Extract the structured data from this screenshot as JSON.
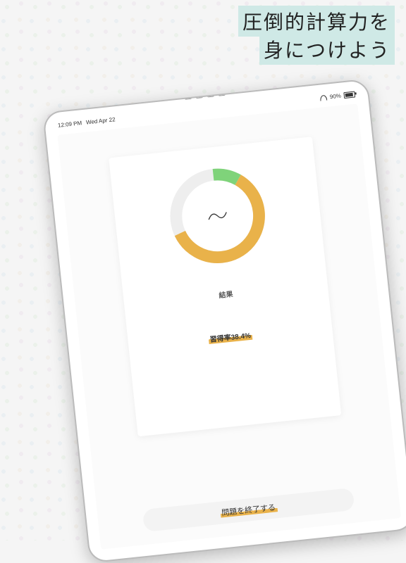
{
  "headline": {
    "line1": "圧倒的計算力を",
    "line2": "身につけよう"
  },
  "statusbar": {
    "time": "12:09 PM",
    "date": "Wed Apr 22",
    "battery": "90%"
  },
  "chart_data": {
    "type": "pie",
    "title": "結果",
    "series": [
      {
        "name": "green-segment",
        "value": 10,
        "color": "#7fd37a"
      },
      {
        "name": "orange-segment",
        "value": 60,
        "color": "#e9b24a"
      },
      {
        "name": "remaining",
        "value": 30,
        "color": "#eeeeee"
      }
    ],
    "annotations": {
      "score_label": "習得率38.4%",
      "score_value": 38.4
    }
  },
  "result_label": "結果",
  "score_text": "習得率38.4%",
  "end_button": "問題を終了する"
}
